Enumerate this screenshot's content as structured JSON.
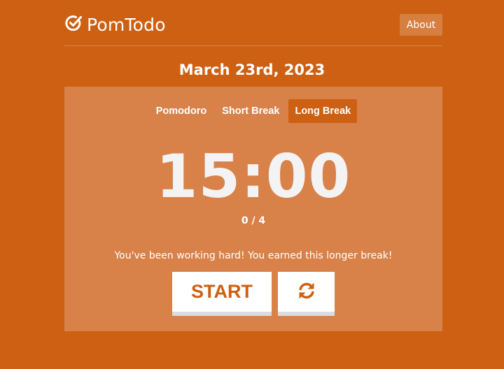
{
  "app": {
    "name": "PomTodo",
    "logo_icon": "check-circle-icon"
  },
  "nav": {
    "about_label": "About"
  },
  "date": "March 23rd, 2023",
  "tabs": [
    {
      "label": "Pomodoro",
      "active": false
    },
    {
      "label": "Short Break",
      "active": false
    },
    {
      "label": "Long Break",
      "active": true
    }
  ],
  "timer": {
    "display": "15:00",
    "counter": "0 / 4"
  },
  "message": "You've been working hard! You earned this longer break!",
  "controls": {
    "start_label": "START",
    "reset_icon": "refresh-icon"
  },
  "colors": {
    "background": "#cd6012",
    "panel": "#d8824a",
    "accent": "#cd6012",
    "timer_text": "#f3f3f3"
  }
}
